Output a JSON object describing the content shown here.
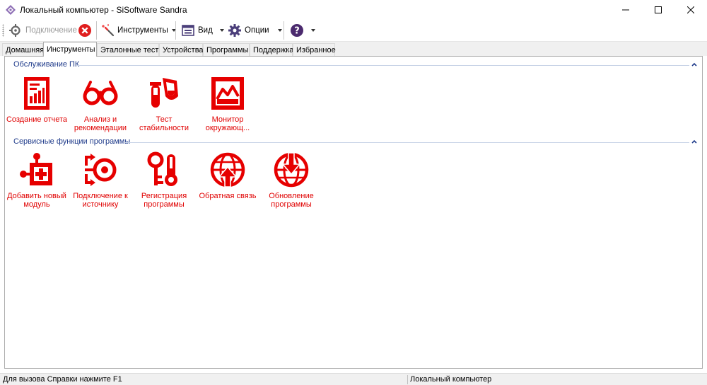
{
  "window": {
    "title": "Локальный компьютер - SiSoftware Sandra"
  },
  "toolbar": {
    "connect_label": "Подключение",
    "tools_label": "Инструменты",
    "view_label": "Вид",
    "options_label": "Опции"
  },
  "tabs": [
    {
      "label": "Домашняя",
      "active": false
    },
    {
      "label": "Инструменты",
      "active": true
    },
    {
      "label": "Эталонные тесты",
      "active": false
    },
    {
      "label": "Устройства",
      "active": false
    },
    {
      "label": "Программы",
      "active": false
    },
    {
      "label": "Поддержка",
      "active": false
    },
    {
      "label": "Избранное",
      "active": false
    }
  ],
  "groups": [
    {
      "title": "Обслуживание ПК",
      "items": [
        {
          "label": "Создание отчета",
          "icon": "report-icon"
        },
        {
          "label": "Анализ и\nрекомендации",
          "icon": "glasses-icon"
        },
        {
          "label": "Тест стабильности",
          "icon": "flask-icon"
        },
        {
          "label": "Монитор\nокружающ...",
          "icon": "monitor-chart-icon"
        }
      ]
    },
    {
      "title": "Сервисные функции программы",
      "items": [
        {
          "label": "Добавить новый\nмодуль",
          "icon": "add-module-icon"
        },
        {
          "label": "Подключение к\nисточнику",
          "icon": "connect-source-icon"
        },
        {
          "label": "Регистрация\nпрограммы",
          "icon": "key-icon"
        },
        {
          "label": "Обратная связь",
          "icon": "globe-up-icon"
        },
        {
          "label": "Обновление\nпрограммы",
          "icon": "globe-down-icon"
        }
      ]
    }
  ],
  "status": {
    "help_hint": "Для вызова Справки нажмите F1",
    "computer": "Локальный компьютер"
  },
  "colors": {
    "accent_red": "#e60000",
    "group_title": "#1e3a8a"
  }
}
